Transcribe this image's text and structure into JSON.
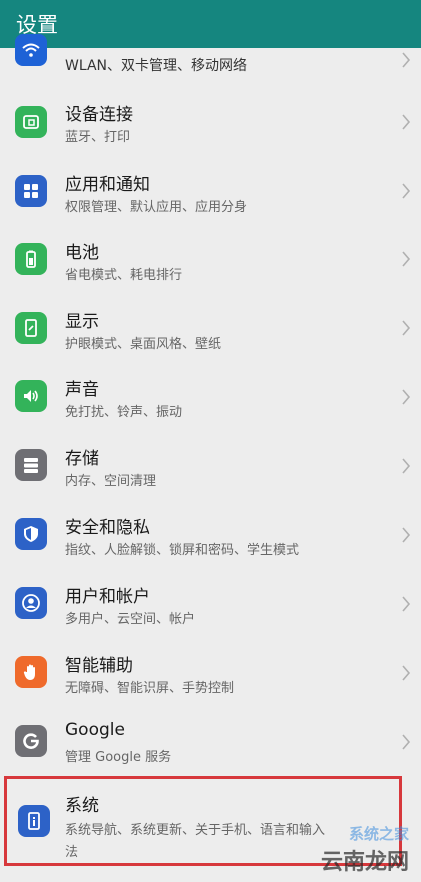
{
  "header": {
    "title": "设置"
  },
  "items": [
    {
      "title": "",
      "subtitle": "WLAN、双卡管理、移动网络",
      "icon": "wifi-icon",
      "color": "#1e62d6"
    },
    {
      "title": "设备连接",
      "subtitle": "蓝牙、打印",
      "icon": "device-connection-icon",
      "color": "#33b35a"
    },
    {
      "title": "应用和通知",
      "subtitle": "权限管理、默认应用、应用分身",
      "icon": "apps-grid-icon",
      "color": "#2d62c7"
    },
    {
      "title": "电池",
      "subtitle": "省电模式、耗电排行",
      "icon": "battery-icon",
      "color": "#33b35a"
    },
    {
      "title": "显示",
      "subtitle": "护眼模式、桌面风格、壁纸",
      "icon": "display-icon",
      "color": "#33b35a"
    },
    {
      "title": "声音",
      "subtitle": "免打扰、铃声、振动",
      "icon": "speaker-icon",
      "color": "#33b35a"
    },
    {
      "title": "存储",
      "subtitle": "内存、空间清理",
      "icon": "storage-icon",
      "color": "#6f6f74"
    },
    {
      "title": "安全和隐私",
      "subtitle": "指纹、人脸解锁、锁屏和密码、学生模式",
      "icon": "shield-icon",
      "color": "#2d62c7"
    },
    {
      "title": "用户和帐户",
      "subtitle": "多用户、云空间、帐户",
      "icon": "user-account-icon",
      "color": "#2d62c7"
    },
    {
      "title": "智能辅助",
      "subtitle": "无障碍、智能识屏、手势控制",
      "icon": "hand-icon",
      "color": "#ef6a2b"
    },
    {
      "title": "Google",
      "subtitle": "管理 Google 服务",
      "icon": "google-icon",
      "color": "#6f6f74"
    },
    {
      "title": "系统",
      "subtitle": "系统导航、系统更新、关于手机、语言和输入",
      "subtitle2": "法",
      "icon": "system-info-icon",
      "color": "#2d62c7"
    }
  ],
  "watermark": {
    "text1": "系统之家",
    "text2": "云南龙网"
  }
}
